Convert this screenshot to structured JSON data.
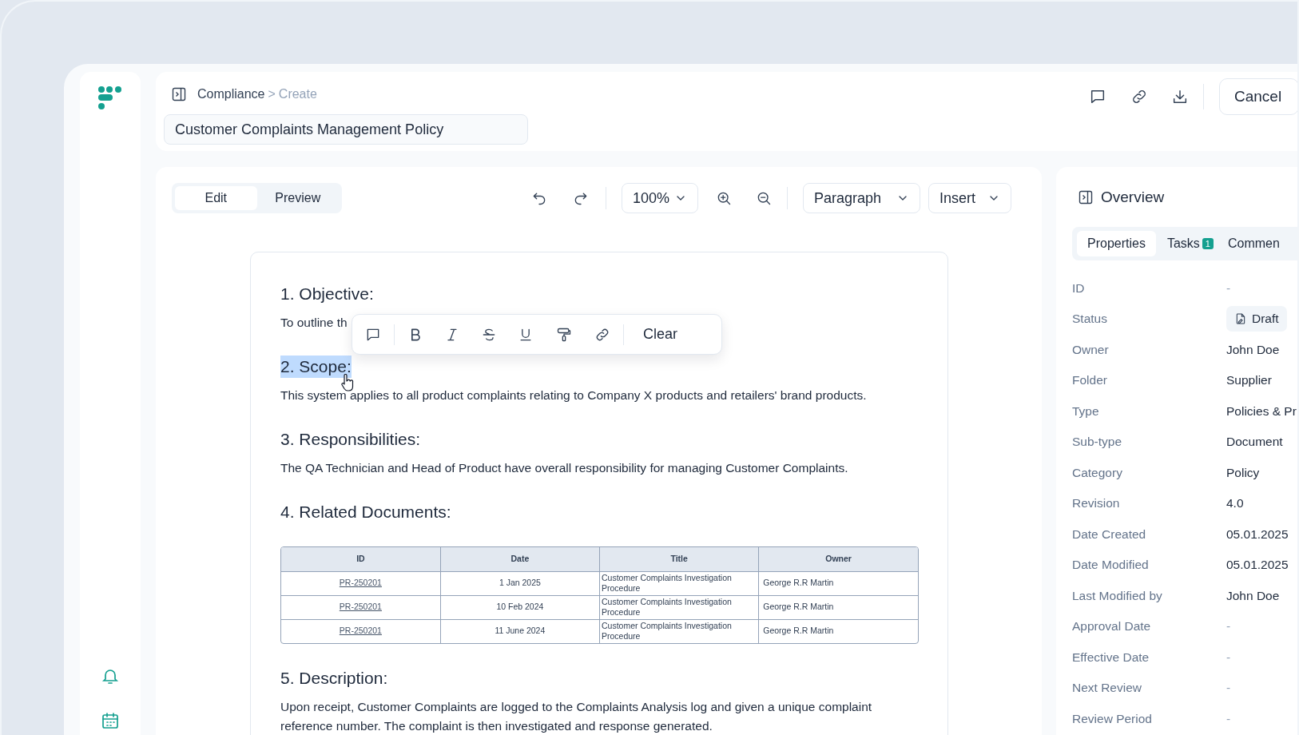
{
  "breadcrumb": {
    "parent": "Compliance",
    "separator": ">",
    "current": "Create"
  },
  "document_title": "Customer Complaints Management Policy",
  "header_actions": {
    "cancel": "Cancel"
  },
  "mode_tabs": [
    {
      "label": "Edit",
      "selected": true
    },
    {
      "label": "Preview",
      "selected": false
    }
  ],
  "toolbar": {
    "zoom": "100%",
    "block_style": "Paragraph",
    "insert": "Insert"
  },
  "format_toolbar": {
    "clear": "Clear"
  },
  "sections": [
    {
      "heading": "1. Objective:",
      "highlighted": false,
      "text": "To outline th"
    },
    {
      "heading": "2. Scope:",
      "highlighted": true,
      "text": "This system applies to all product complaints relating to Company X products and retailers' brand products."
    },
    {
      "heading": "3. Responsibilities:",
      "highlighted": false,
      "text": "The QA Technician and Head of Product have overall responsibility for managing Customer Complaints."
    },
    {
      "heading": "4. Related Documents:",
      "highlighted": false,
      "table": {
        "columns": [
          "ID",
          "Date",
          "Title",
          "Owner"
        ],
        "rows": [
          {
            "id": "PR-250201",
            "date": "1 Jan 2025",
            "title": "Customer Complaints Investigation Procedure",
            "owner": "George R.R Martin"
          },
          {
            "id": "PR-250201",
            "date": "10 Feb 2024",
            "title": "Customer Complaints Investigation Procedure",
            "owner": "George R.R Martin"
          },
          {
            "id": "PR-250201",
            "date": "11 June 2024",
            "title": "Customer Complaints Investigation Procedure",
            "owner": "George R.R Martin"
          }
        ]
      }
    },
    {
      "heading": "5. Description:",
      "highlighted": false,
      "text": "Upon receipt, Customer Complaints are logged to the Complaints Analysis log and given a unique complaint reference number. The complaint is then investigated and response generated."
    }
  ],
  "overview": {
    "title": "Overview",
    "tabs": [
      {
        "label": "Properties",
        "selected": true
      },
      {
        "label": "Tasks",
        "badge": "1",
        "selected": false
      },
      {
        "label": "Commen",
        "selected": false
      }
    ],
    "properties": [
      {
        "label": "ID",
        "value": "-",
        "kind": "empty"
      },
      {
        "label": "Status",
        "value": "Draft",
        "kind": "badge"
      },
      {
        "label": "Owner",
        "value": "John Doe",
        "kind": "text"
      },
      {
        "label": "Folder",
        "value": "Supplier",
        "kind": "text"
      },
      {
        "label": "Type",
        "value": "Policies & Pr",
        "kind": "text"
      },
      {
        "label": "Sub-type",
        "value": "Document",
        "kind": "text"
      },
      {
        "label": "Category",
        "value": "Policy",
        "kind": "text"
      },
      {
        "label": "Revision",
        "value": "4.0",
        "kind": "text"
      },
      {
        "label": "Date Created",
        "value": "05.01.2025",
        "kind": "text"
      },
      {
        "label": "Date Modified",
        "value": "05.01.2025",
        "kind": "text"
      },
      {
        "label": "Last Modified by",
        "value": "John Doe",
        "kind": "text"
      },
      {
        "label": "Approval Date",
        "value": "-",
        "kind": "empty"
      },
      {
        "label": "Effective Date",
        "value": "-",
        "kind": "empty"
      },
      {
        "label": "Next Review",
        "value": "-",
        "kind": "empty"
      },
      {
        "label": "Review Period",
        "value": "-",
        "kind": "empty"
      }
    ]
  }
}
